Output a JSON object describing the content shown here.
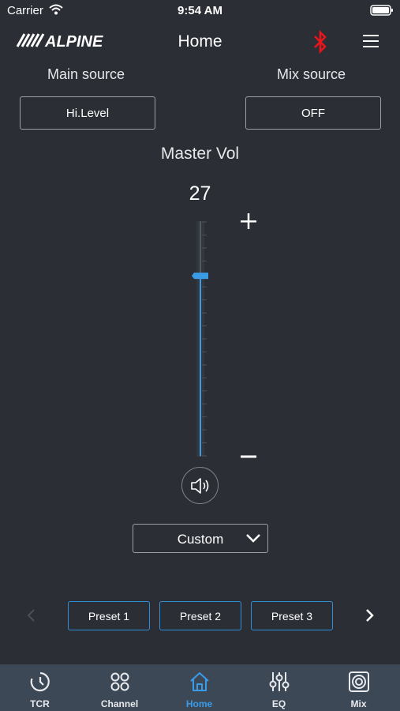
{
  "status_bar": {
    "carrier": "Carrier",
    "time": "9:54 AM"
  },
  "header": {
    "logo": "ALPINE",
    "title": "Home",
    "bluetooth_color": "#e8151b"
  },
  "sources": {
    "main_label": "Main source",
    "main_value": "Hi.Level",
    "mix_label": "Mix source",
    "mix_value": "OFF"
  },
  "master": {
    "label": "Master Vol",
    "value": "27",
    "slider_level": 0.77,
    "plus": "+",
    "minus": "−"
  },
  "preset_select": {
    "value": "Custom"
  },
  "presets": [
    "Preset 1",
    "Preset 2",
    "Preset 3"
  ],
  "tabs": [
    {
      "label": "TCR",
      "icon": "clock-icon",
      "active": false
    },
    {
      "label": "Channel",
      "icon": "grid-icon",
      "active": false
    },
    {
      "label": "Home",
      "icon": "home-icon",
      "active": true
    },
    {
      "label": "EQ",
      "icon": "sliders-icon",
      "active": false
    },
    {
      "label": "Mix",
      "icon": "target-icon",
      "active": false
    }
  ],
  "colors": {
    "background": "#2b2f35",
    "accent": "#3a9be6",
    "tab_bar": "#3d4856"
  }
}
